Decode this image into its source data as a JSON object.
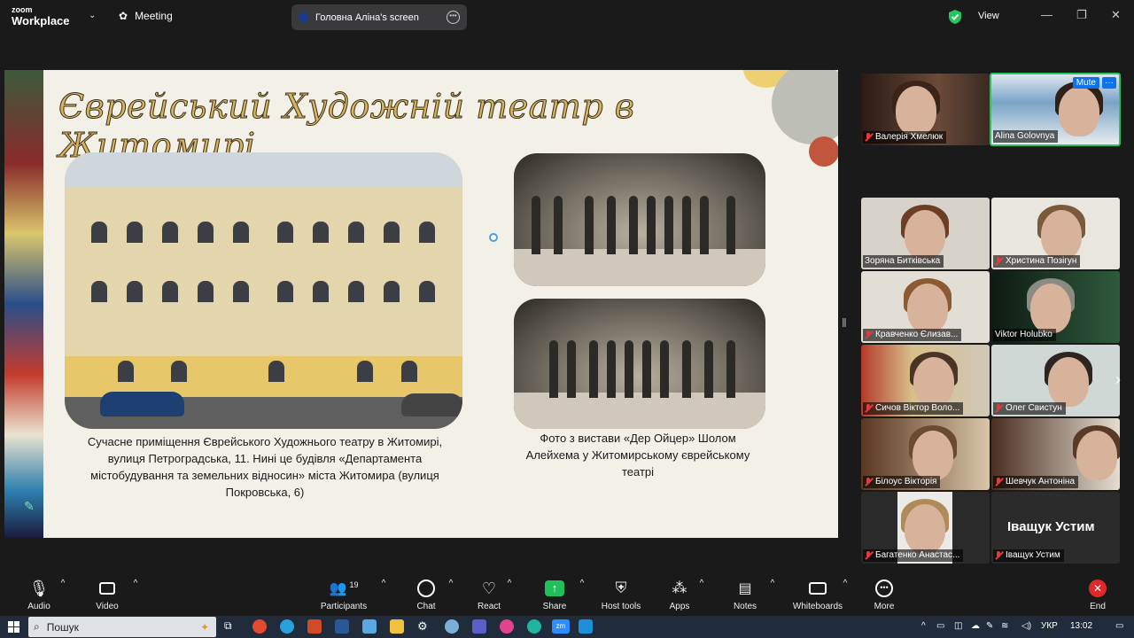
{
  "app": {
    "brand_top": "zoom",
    "brand_bottom": "Workplace",
    "meeting_label": "Meeting"
  },
  "share": {
    "label": "Головна Аліна's screen"
  },
  "header": {
    "view_label": "View"
  },
  "slide": {
    "title": "Єврейський Художній театр в Житомирі",
    "caption_left": "Сучасне приміщення Єврейського Художнього театру в Житомирі, вулиця Петроградська, 11. Нині це будівля «Департамента містобудування та земельних відносин» міста Житомира (вулиця Покровська, 6)",
    "caption_right": "Фото з вистави «Дер Ойцер» Шолом Алейхема у Житомирському єврейському театрі"
  },
  "top_tiles": [
    {
      "name": "Валерія  Хмелюк",
      "muted": true
    },
    {
      "name": "Alina Golovnya",
      "muted": false,
      "mute_button": "Mute",
      "more": "···"
    }
  ],
  "gallery": [
    {
      "name": "Зоряна Битківська",
      "muted": false
    },
    {
      "name": "Христина Позігун",
      "muted": true
    },
    {
      "name": "Кравченко Єлизав...",
      "muted": true
    },
    {
      "name": "Viktor Holubko",
      "muted": false
    },
    {
      "name": "Сичов Віктор Воло...",
      "muted": true
    },
    {
      "name": "Олег Свистун",
      "muted": true
    },
    {
      "name": "Білоус Вікторія",
      "muted": true
    },
    {
      "name": "Шевчук Антоніна",
      "muted": true
    },
    {
      "name": "Багатенко Анастас...",
      "muted": true
    },
    {
      "name": "Іващук Устим",
      "muted": true
    }
  ],
  "big_name": "Іващук Устим",
  "toolbar": {
    "audio": "Audio",
    "video": "Video",
    "participants": "Participants",
    "participants_count": "19",
    "chat": "Chat",
    "react": "React",
    "share": "Share",
    "host_tools": "Host tools",
    "apps": "Apps",
    "notes": "Notes",
    "whiteboards": "Whiteboards",
    "more": "More",
    "end": "End"
  },
  "taskbar": {
    "search_placeholder": "Пошук",
    "lang": "УКР",
    "time": "13:02"
  },
  "colors": {
    "active_border": "#23c55e",
    "share_green": "#1fbf5b",
    "end_red": "#e02828",
    "accent_blue": "#0e72ed"
  }
}
